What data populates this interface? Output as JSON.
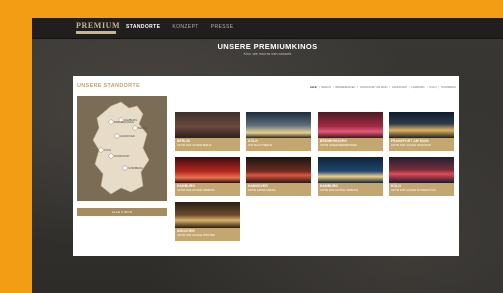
{
  "brand": {
    "logo": "PREMIUM"
  },
  "nav": {
    "items": [
      {
        "label": "STANDORTE",
        "active": true
      },
      {
        "label": "KONZEPT",
        "active": false
      },
      {
        "label": "PRESSE",
        "active": false
      }
    ]
  },
  "hero": {
    "title": "UNSERE PREMIUMKINOS",
    "subtitle": "Kino, wie man es sich wünscht"
  },
  "panel": {
    "title": "UNSERE STANDORTE",
    "filters": [
      "ALLE",
      "BERLIN",
      "BREMERHAVEN",
      "FRANKFURT AM MAIN",
      "HANNOVER",
      "HAMBURG",
      "KÖLN",
      "NÜRNBERG"
    ],
    "map_button": "ALLE KINOS",
    "map_labels": [
      "HAMBURG",
      "BREMERHAVEN",
      "HANNOVER",
      "BERLIN",
      "KÖLN",
      "FRANKFURT",
      "NÜRNBERG"
    ]
  },
  "cinemas": [
    {
      "city": "BERLIN",
      "desc": "ASTOR FILM LOUNGE BERLIN"
    },
    {
      "city": "KÖLN",
      "desc": "ZOO PALAST BERLIN"
    },
    {
      "city": "BREMERHAVEN",
      "desc": "ASTOR CINEMA BREMERHAVEN"
    },
    {
      "city": "FRANKFURT AM MAIN",
      "desc": "ASTOR FILM LOUNGE FRANKFURT"
    },
    {
      "city": "HAMBURG",
      "desc": "ASTOR FILM LOUNGE HAMBURG"
    },
    {
      "city": "HANNOVER",
      "desc": "ASTOR GRAND CINEMA"
    },
    {
      "city": "HAMBURG",
      "desc": "ASTOR FILM LOUNGE HAMBURG"
    },
    {
      "city": "KÖLN",
      "desc": "ASTOR FILM LOUNGE IM ODEON KÖLN"
    },
    {
      "city": "MÜNCHEN",
      "desc": "ASTOR FILM LOUNGE MÜNCHEN"
    }
  ],
  "colors": {
    "accent": "#c3a670",
    "frame": "#f29d13",
    "background": "#302e2b"
  }
}
